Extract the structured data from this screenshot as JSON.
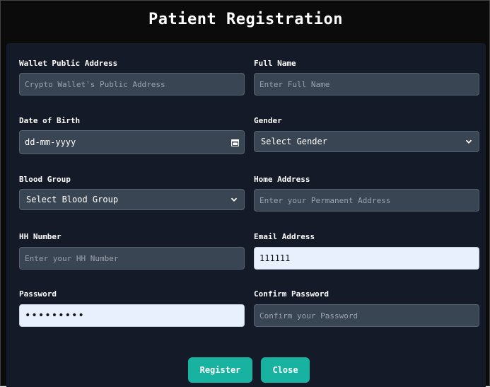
{
  "title": "Patient Registration",
  "fields": {
    "wallet": {
      "label": "Wallet Public Address",
      "placeholder": "Crypto Wallet's Public Address"
    },
    "full_name": {
      "label": "Full Name",
      "placeholder": "Enter Full Name"
    },
    "dob": {
      "label": "Date of Birth",
      "value": "dd-mm-yyyy"
    },
    "gender": {
      "label": "Gender",
      "value": "Select Gender"
    },
    "blood_group": {
      "label": "Blood Group",
      "value": "Select Blood Group"
    },
    "home_address": {
      "label": "Home Address",
      "placeholder": "Enter your Permanent Address"
    },
    "hh_number": {
      "label": "HH Number",
      "placeholder": "Enter your HH Number"
    },
    "email": {
      "label": "Email Address",
      "value": "111111"
    },
    "password": {
      "label": "Password",
      "value": "•••••••••"
    },
    "confirm_password": {
      "label": "Confirm Password",
      "placeholder": "Confirm your Password"
    }
  },
  "buttons": {
    "register": "Register",
    "close": "Close"
  },
  "colors": {
    "background": "#0b0b0c",
    "panel": "#141a28",
    "input": "#3a4554",
    "autofill": "#e8f0fe",
    "accent": "#17b2a0"
  }
}
